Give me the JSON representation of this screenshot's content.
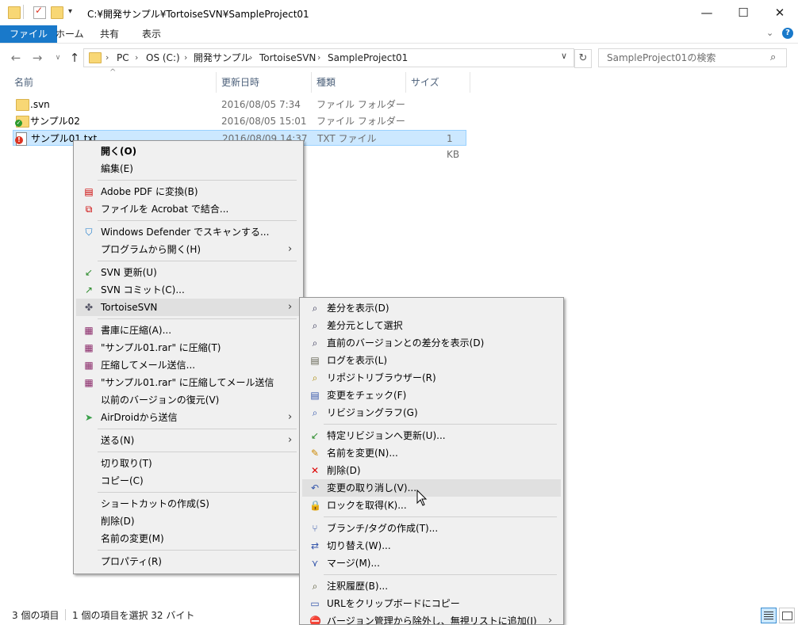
{
  "window": {
    "title": "C:¥開発サンプル¥TortoiseSVN¥SampleProject01",
    "controls": {
      "minimize": "—",
      "maximize": "☐",
      "close": "✕"
    }
  },
  "ribbon": {
    "tabs": [
      "ファイル",
      "ホーム",
      "共有",
      "表示"
    ],
    "active_tab": "ファイル"
  },
  "address": {
    "crumbs": [
      "PC",
      "OS (C:)",
      "開発サンプル",
      "TortoiseSVN",
      "SampleProject01"
    ],
    "search_placeholder": "SampleProject01の検索"
  },
  "columns": [
    "名前",
    "更新日時",
    "種類",
    "サイズ"
  ],
  "files": [
    {
      "name": ".svn",
      "date": "2016/08/05 7:34",
      "type": "ファイル フォルダー",
      "size": "",
      "icon": "folder-icon",
      "selected": false
    },
    {
      "name": "サンプル02",
      "date": "2016/08/05 15:01",
      "type": "ファイル フォルダー",
      "size": "",
      "icon": "svn-normal-folder-icon",
      "selected": false
    },
    {
      "name": "サンプル01.txt",
      "date": "2016/08/09 14:37",
      "type": "TXT ファイル",
      "size": "1 KB",
      "icon": "svn-modified-file-icon",
      "selected": true
    }
  ],
  "context_menu": {
    "items": [
      {
        "label": "開く(O)",
        "bold": true
      },
      {
        "label": "編集(E)"
      },
      {
        "sep": true
      },
      {
        "label": "Adobe PDF に変換(B)",
        "icon": "pdf-icon"
      },
      {
        "label": "ファイルを Acrobat で結合...",
        "icon": "acrobat-combine-icon"
      },
      {
        "sep": true
      },
      {
        "label": "Windows Defender でスキャンする...",
        "icon": "defender-icon"
      },
      {
        "label": "プログラムから開く(H)",
        "submenu": true
      },
      {
        "sep": true
      },
      {
        "label": "SVN 更新(U)",
        "icon": "svn-update-icon"
      },
      {
        "label": "SVN コミット(C)...",
        "icon": "svn-commit-icon"
      },
      {
        "label": "TortoiseSVN",
        "icon": "tortoisesvn-icon",
        "submenu": true,
        "highlighted": true
      },
      {
        "sep": true
      },
      {
        "label": "書庫に圧縮(A)...",
        "icon": "winrar-icon"
      },
      {
        "label": "\"サンプル01.rar\" に圧縮(T)",
        "icon": "winrar-icon"
      },
      {
        "label": "圧縮してメール送信...",
        "icon": "winrar-icon"
      },
      {
        "label": "\"サンプル01.rar\" に圧縮してメール送信",
        "icon": "winrar-icon"
      },
      {
        "label": "以前のバージョンの復元(V)"
      },
      {
        "label": "AirDroidから送信",
        "icon": "airdroid-icon",
        "submenu": true
      },
      {
        "sep": true
      },
      {
        "label": "送る(N)",
        "submenu": true
      },
      {
        "sep": true
      },
      {
        "label": "切り取り(T)"
      },
      {
        "label": "コピー(C)"
      },
      {
        "sep": true
      },
      {
        "label": "ショートカットの作成(S)"
      },
      {
        "label": "削除(D)"
      },
      {
        "label": "名前の変更(M)"
      },
      {
        "sep": true
      },
      {
        "label": "プロパティ(R)"
      }
    ]
  },
  "tortoise_menu": {
    "items": [
      {
        "label": "差分を表示(D)",
        "icon": "diff-icon"
      },
      {
        "label": "差分元として選択",
        "icon": "diff-icon"
      },
      {
        "label": "直前のバージョンとの差分を表示(D)",
        "icon": "diff-icon"
      },
      {
        "label": "ログを表示(L)",
        "icon": "log-icon"
      },
      {
        "label": "リポジトリブラウザー(R)",
        "icon": "repo-browser-icon"
      },
      {
        "label": "変更をチェック(F)",
        "icon": "check-modifications-icon"
      },
      {
        "label": "リビジョングラフ(G)",
        "icon": "revision-graph-icon"
      },
      {
        "sep": true
      },
      {
        "label": "特定リビジョンへ更新(U)...",
        "icon": "update-to-revision-icon"
      },
      {
        "label": "名前を変更(N)...",
        "icon": "rename-icon"
      },
      {
        "label": "削除(D)",
        "icon": "delete-icon"
      },
      {
        "label": "変更の取り消し(V)...",
        "icon": "revert-icon",
        "highlighted": true
      },
      {
        "label": "ロックを取得(K)...",
        "icon": "lock-icon"
      },
      {
        "sep": true
      },
      {
        "label": "ブランチ/タグの作成(T)...",
        "icon": "branch-icon"
      },
      {
        "label": "切り替え(W)...",
        "icon": "switch-icon"
      },
      {
        "label": "マージ(M)...",
        "icon": "merge-icon"
      },
      {
        "sep": true
      },
      {
        "label": "注釈履歴(B)...",
        "icon": "blame-icon"
      },
      {
        "label": "URLをクリップボードにコピー",
        "icon": "copy-url-icon"
      },
      {
        "label": "バージョン管理から除外し、無視リストに追加(I)",
        "icon": "ignore-icon",
        "submenu": true
      }
    ]
  },
  "status": {
    "count": "3 個の項目",
    "selection": "1 個の項目を選択  32 バイト"
  },
  "colors": {
    "accent": "#1979ca",
    "selection": "#cce8ff",
    "menu_bg": "#f0f0f0"
  }
}
